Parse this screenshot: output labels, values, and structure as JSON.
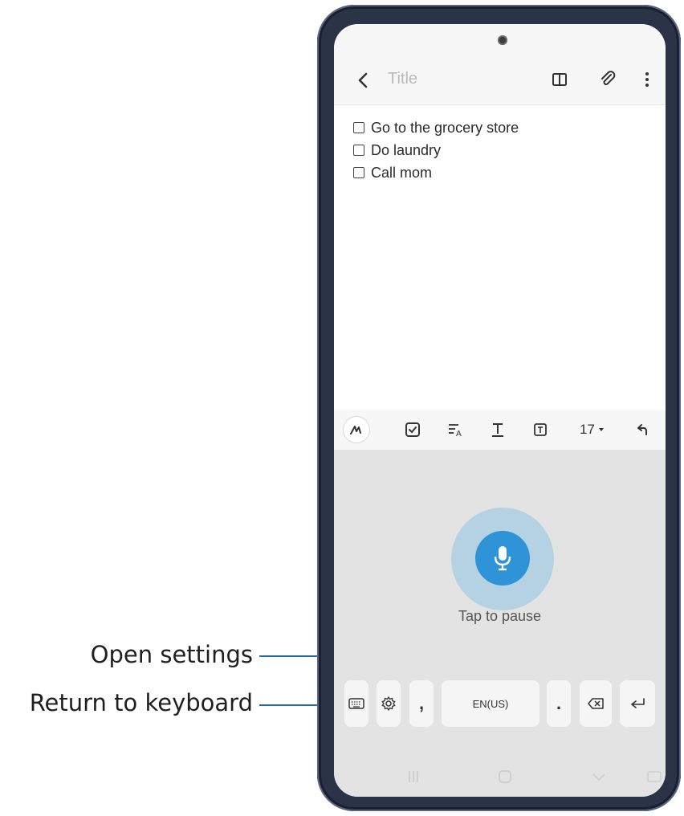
{
  "callouts": {
    "open_settings": "Open settings",
    "return_to_keyboard": "Return to keyboard"
  },
  "note": {
    "title_placeholder": "Title",
    "checklist": [
      "Go to the grocery store",
      "Do laundry",
      "Call mom"
    ]
  },
  "toolbar": {
    "font_size": "17",
    "icons": [
      "pen-icon",
      "checkbox-icon",
      "text-style-icon",
      "text-underline-icon",
      "text-box-icon",
      "undo-icon"
    ]
  },
  "voice": {
    "status": "Tap to pause"
  },
  "keyboard": {
    "comma": ",",
    "language": "EN(US)",
    "period": "."
  },
  "header_icons": [
    "back-icon",
    "reading-mode-icon",
    "attach-icon",
    "more-options-icon"
  ],
  "colors": {
    "mic_accent": "#2f93d8",
    "callout_line": "#1e6fa8"
  }
}
